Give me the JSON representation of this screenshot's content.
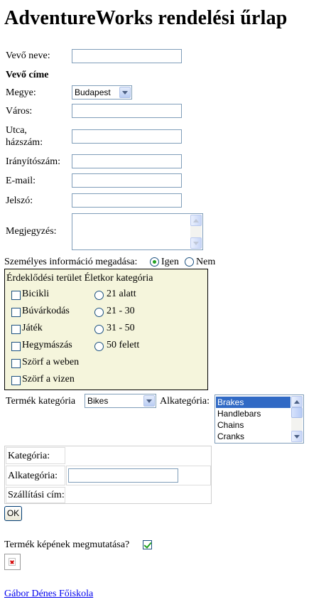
{
  "page": {
    "title": "AdventureWorks rendelési űrlap"
  },
  "customer": {
    "name_label": "Vevő neve:",
    "name_value": "",
    "address_heading": "Vevő címe",
    "county_label": "Megye:",
    "county_value": "Budapest",
    "city_label": "Város:",
    "street_label_line1": "Utca,",
    "street_label_line2": "házszám:",
    "zip_label": "Irányítószám:",
    "email_label": "E-mail:",
    "password_label": "Jelszó:",
    "note_label": "Megjegyzés:"
  },
  "personal_info": {
    "question": "Személyes információ megadása:",
    "options": [
      {
        "label": "Igen",
        "checked": true
      },
      {
        "label": "Nem",
        "checked": false
      }
    ]
  },
  "interests": {
    "header": "Érdeklődési terület Életkor kategória",
    "items": [
      {
        "label": "Bicikli",
        "checked": false
      },
      {
        "label": "Búvárkodás",
        "checked": false
      },
      {
        "label": "Játék",
        "checked": false
      },
      {
        "label": "Hegymászás",
        "checked": false
      },
      {
        "label": "Szörf a weben",
        "checked": false
      },
      {
        "label": "Szörf a vizen",
        "checked": false
      }
    ],
    "age_groups": [
      {
        "label": "21 alatt",
        "checked": false
      },
      {
        "label": "21 - 30",
        "checked": false
      },
      {
        "label": "31 - 50",
        "checked": false
      },
      {
        "label": "50 felett",
        "checked": false
      }
    ]
  },
  "product": {
    "category_label": "Termék kategória",
    "category_value": "Bikes",
    "subcategory_label": "Alkategória:",
    "subcategories": [
      {
        "label": "Brakes",
        "selected": true
      },
      {
        "label": "Handlebars",
        "selected": false
      },
      {
        "label": "Chains",
        "selected": false
      },
      {
        "label": "Cranks",
        "selected": false
      }
    ]
  },
  "details": {
    "category_label": "Kategória:",
    "subcategory_label": "Alkategória:",
    "shipping_label": "Szállítási cím:"
  },
  "ok_button": "OK",
  "show_image": {
    "label": "Termék képének megmutatása?",
    "checked": true
  },
  "footer_link": "Gábor Dénes Főiskola",
  "colors": {
    "panel_bg": "#f5f5dc",
    "selection": "#316ac5",
    "link": "#0000ee",
    "check": "#21a121"
  }
}
